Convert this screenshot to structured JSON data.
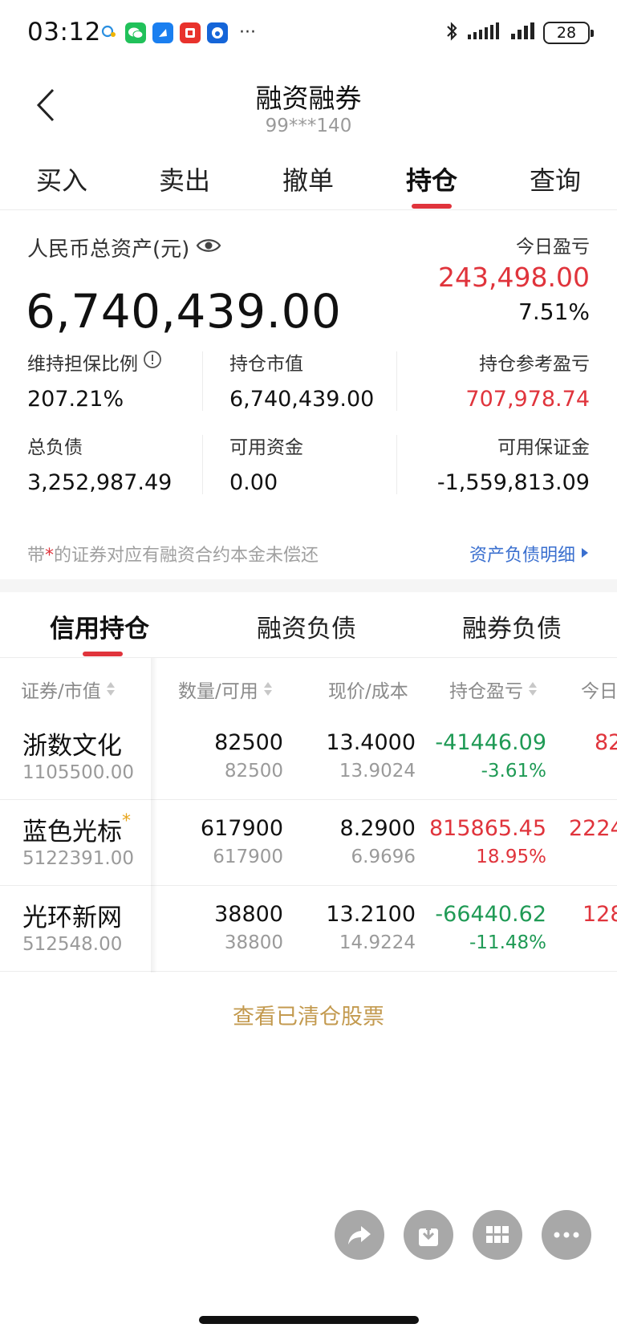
{
  "status_bar": {
    "time": "03:12",
    "battery": "28",
    "more": "···"
  },
  "header": {
    "title": "融资融券",
    "account": "99***140"
  },
  "main_tabs": [
    {
      "label": "买入"
    },
    {
      "label": "卖出"
    },
    {
      "label": "撤单"
    },
    {
      "label": "持仓",
      "active": true
    },
    {
      "label": "查询"
    }
  ],
  "asset": {
    "total_label": "人民币总资产(元)",
    "total_value": "6,740,439.00",
    "today_label": "今日盈亏",
    "today_amount": "243,498.00",
    "today_pct": "7.51%",
    "metrics": {
      "ratio_label": "维持担保比例",
      "ratio_value": "207.21%",
      "market_value_label": "持仓市值",
      "market_value": "6,740,439.00",
      "ref_pl_label": "持仓参考盈亏",
      "ref_pl_value": "707,978.74",
      "liability_label": "总负债",
      "liability_value": "3,252,987.49",
      "cash_label": "可用资金",
      "cash_value": "0.00",
      "margin_label": "可用保证金",
      "margin_value": "-1,559,813.09"
    },
    "note_prefix": "带",
    "note_star": "*",
    "note_suffix": "的证券对应有融资合约本金未偿还",
    "detail_link": "资产负债明细"
  },
  "sub_tabs": [
    {
      "label": "信用持仓",
      "active": true
    },
    {
      "label": "融资负债"
    },
    {
      "label": "融券负债"
    }
  ],
  "table": {
    "headers": [
      "证券/市值",
      "数量/可用",
      "现价/成本",
      "持仓盈亏",
      "今日"
    ],
    "rows": [
      {
        "name": "浙数文化",
        "star": "",
        "market_value": "1105500.00",
        "qty": "82500",
        "avail": "82500",
        "price": "13.4000",
        "cost": "13.9024",
        "pl": "-41446.09",
        "pl_pct": "-3.61%",
        "pl_dir": "down",
        "today": "82"
      },
      {
        "name": "蓝色光标",
        "star": "*",
        "market_value": "5122391.00",
        "qty": "617900",
        "avail": "617900",
        "price": "8.2900",
        "cost": "6.9696",
        "pl": "815865.45",
        "pl_pct": "18.95%",
        "pl_dir": "up",
        "today": "2224"
      },
      {
        "name": "光环新网",
        "star": "",
        "market_value": "512548.00",
        "qty": "38800",
        "avail": "38800",
        "price": "13.2100",
        "cost": "14.9224",
        "pl": "-66440.62",
        "pl_pct": "-11.48%",
        "pl_dir": "down",
        "today": "128"
      }
    ]
  },
  "view_cleared": "查看已清仓股票",
  "colors": {
    "up": "#e0343c",
    "down": "#1f9a55",
    "link": "#3a6fcf",
    "gold": "#c39a4f"
  }
}
